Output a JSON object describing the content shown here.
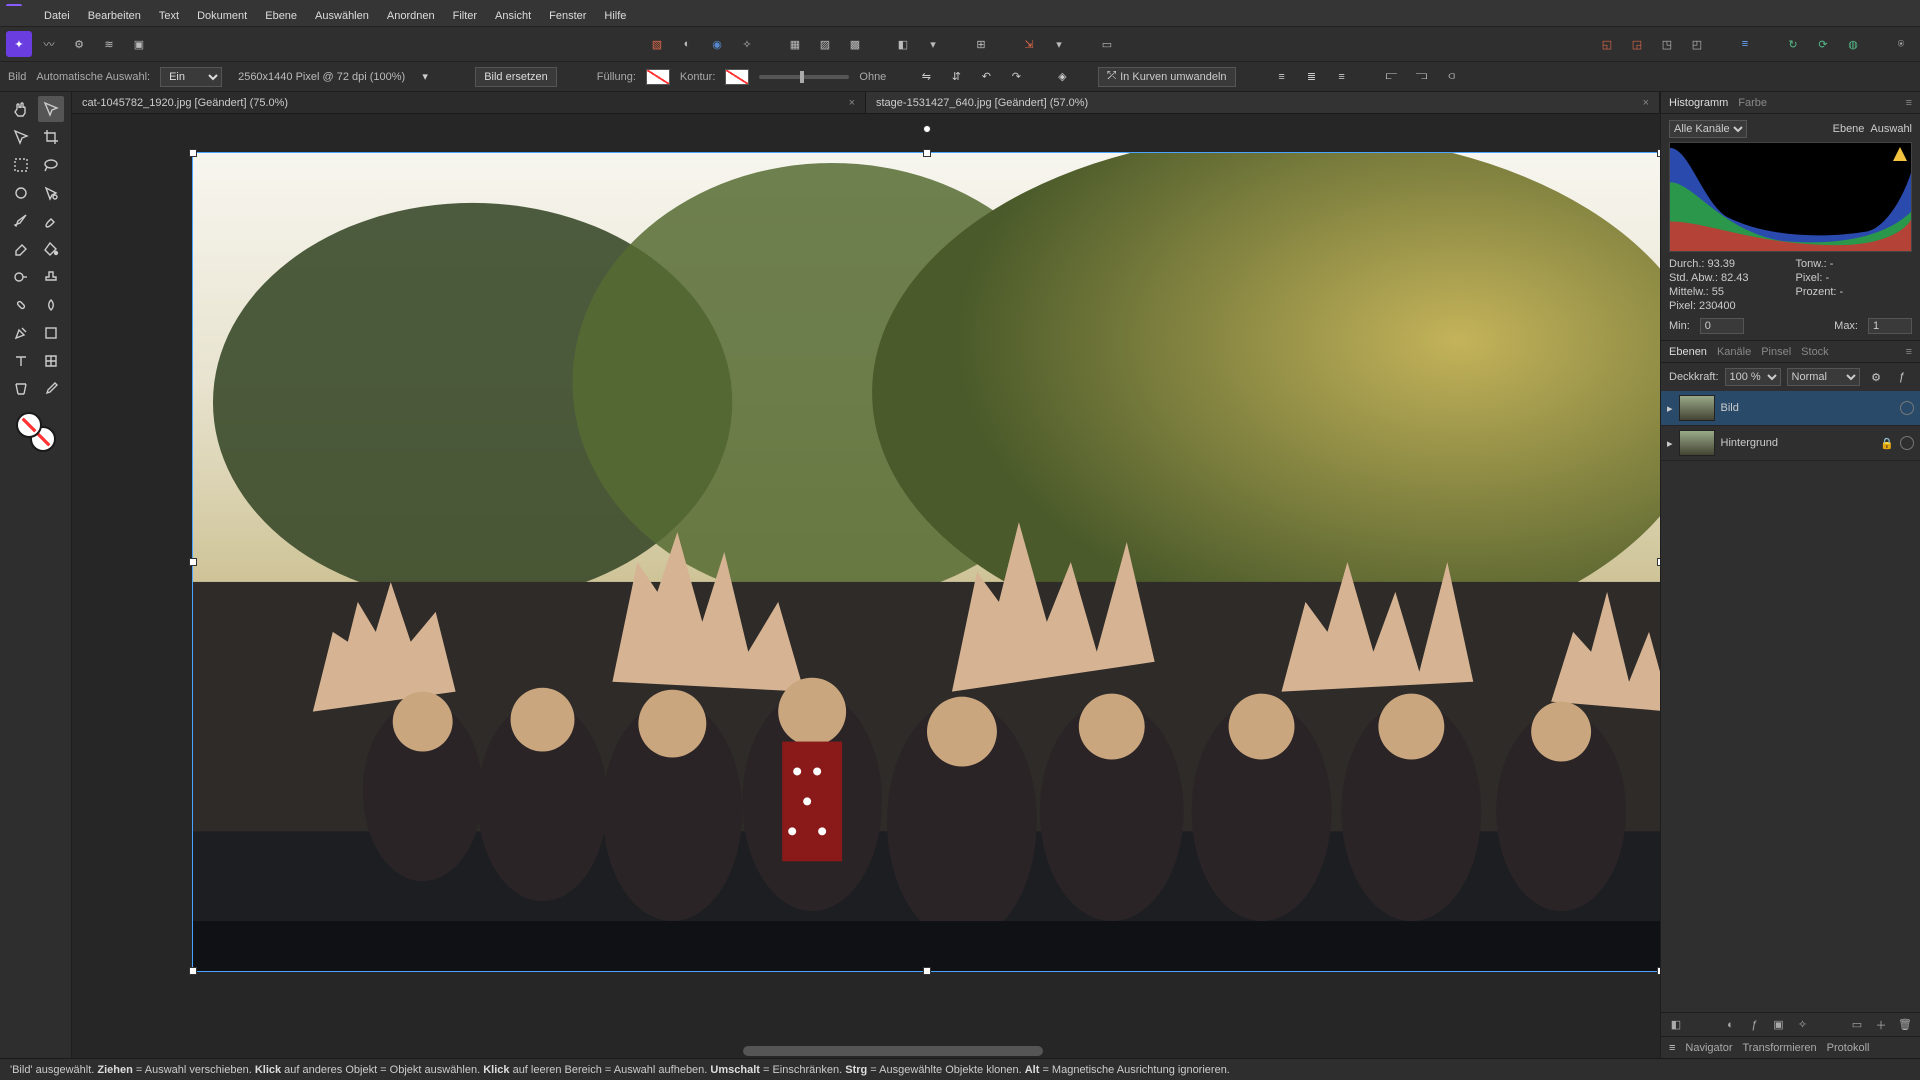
{
  "menu": {
    "items": [
      "Datei",
      "Bearbeiten",
      "Text",
      "Dokument",
      "Ebene",
      "Auswählen",
      "Anordnen",
      "Filter",
      "Ansicht",
      "Fenster",
      "Hilfe"
    ]
  },
  "context": {
    "label_bild": "Bild",
    "label_auto": "Automatische Auswahl:",
    "auto_value": "Ein",
    "dims": "2560x1440 Pixel @ 72 dpi (100%)",
    "replace": "Bild ersetzen",
    "fill": "Füllung:",
    "stroke": "Kontur:",
    "none": "Ohne",
    "curves": "In Kurven umwandeln"
  },
  "tabs": [
    {
      "title": "cat-1045782_1920.jpg [Geändert] (75.0%)",
      "active": false
    },
    {
      "title": "stage-1531427_640.jpg [Geändert] (57.0%)",
      "active": true
    }
  ],
  "panels": {
    "histo_tab": "Histogramm",
    "farbe_tab": "Farbe",
    "channel": "Alle Kanäle",
    "ebene": "Ebene",
    "auswahl": "Auswahl",
    "stat_durch": "Durch.: 93.39",
    "stat_tonw": "Tonw.: -",
    "stat_std": "Std. Abw.: 82.43",
    "stat_pixel2": "Pixel: -",
    "stat_mittel": "Mittelw.: 55",
    "stat_prozent": "Prozent: -",
    "stat_pixel": "Pixel: 230400",
    "min_lbl": "Min:",
    "min_val": "0",
    "max_lbl": "Max:",
    "max_val": "1",
    "tabs2": [
      "Ebenen",
      "Kanäle",
      "Pinsel",
      "Stock"
    ],
    "opacity_lbl": "Deckkraft:",
    "opacity": "100 %",
    "blend": "Normal",
    "layers": [
      {
        "name": "Bild",
        "sel": true,
        "locked": false
      },
      {
        "name": "Hintergrund",
        "sel": false,
        "locked": true
      }
    ],
    "bottom": [
      "Navigator",
      "Transformieren",
      "Protokoll"
    ]
  },
  "status": {
    "t1": "'Bild' ausgewählt. ",
    "b1": "Ziehen",
    "t2": " = Auswahl verschieben. ",
    "b2": "Klick",
    "t3": " auf anderes Objekt = Objekt auswählen. ",
    "b3": "Klick",
    "t4": " auf leeren Bereich = Auswahl aufheben. ",
    "b4": "Umschalt",
    "t5": " = Einschränken. ",
    "b5": "Strg",
    "t6": " = Ausgewählte Objekte klonen. ",
    "b6": "Alt",
    "t7": " = Magnetische Ausrichtung ignorieren."
  }
}
